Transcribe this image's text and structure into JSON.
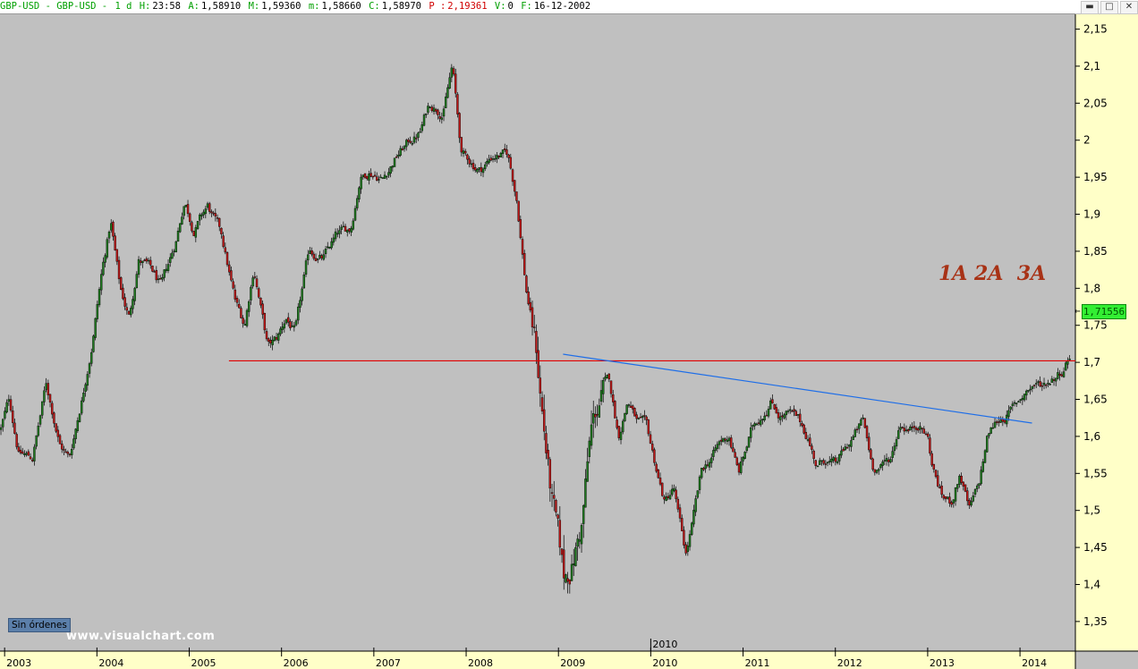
{
  "header": {
    "symbol": "GBP-USD - GBP-USD -",
    "period": "1 d",
    "h_label": "H:",
    "h_value": "23:58",
    "a_label": "A:",
    "a_value": "1,58910",
    "m_label": "M:",
    "m_value": "1,59360",
    "mn_label": "m:",
    "mn_value": "1,58660",
    "c_label": "C:",
    "c_value": "1,58970",
    "p_label": "P :",
    "p_value": "2,19361",
    "v_label": "V:",
    "v_value": "0",
    "f_label": "F:",
    "f_value": "16-12-2002"
  },
  "window_controls": [
    "▬",
    "□",
    "✕"
  ],
  "current_price": "1,71556",
  "annotation": "1A 2A  3A",
  "orders_button": "Sin órdenes",
  "watermark": "www.visualchart.com",
  "colors": {
    "up": "#1f7a1f",
    "down": "#c01818",
    "support_line": "#e00000",
    "trend_line": "#1e6ee8",
    "background": "#c0c0c0",
    "axis_bg": "#ffffc8"
  },
  "chart_data": {
    "type": "candlestick",
    "instrument": "GBP-USD",
    "timeframe": "1 d",
    "x_tick_labels": [
      "2003",
      "2004",
      "2005",
      "2006",
      "2007",
      "2008",
      "2009",
      "2010",
      "2011",
      "2012",
      "2013",
      "2014"
    ],
    "x_cursor_label": "2010",
    "y_tick_labels": [
      "2,15",
      "2,1",
      "2,05",
      "2",
      "1,95",
      "1,9",
      "1,85",
      "1,8",
      "1,75",
      "1,7",
      "1,65",
      "1,6",
      "1,55",
      "1,5",
      "1,45",
      "1,4",
      "1,35"
    ],
    "ylim": [
      1.31,
      2.17
    ],
    "xlim": [
      2002.95,
      2014.6
    ],
    "path": [
      [
        2002.96,
        1.61
      ],
      [
        2003.05,
        1.65
      ],
      [
        2003.15,
        1.58
      ],
      [
        2003.3,
        1.57
      ],
      [
        2003.45,
        1.67
      ],
      [
        2003.6,
        1.59
      ],
      [
        2003.7,
        1.57
      ],
      [
        2003.85,
        1.66
      ],
      [
        2003.95,
        1.73
      ],
      [
        2004.05,
        1.82
      ],
      [
        2004.15,
        1.89
      ],
      [
        2004.25,
        1.8
      ],
      [
        2004.35,
        1.76
      ],
      [
        2004.45,
        1.84
      ],
      [
        2004.55,
        1.83
      ],
      [
        2004.7,
        1.8
      ],
      [
        2004.85,
        1.86
      ],
      [
        2004.95,
        1.92
      ],
      [
        2005.05,
        1.88
      ],
      [
        2005.2,
        1.91
      ],
      [
        2005.35,
        1.87
      ],
      [
        2005.5,
        1.78
      ],
      [
        2005.6,
        1.75
      ],
      [
        2005.7,
        1.83
      ],
      [
        2005.85,
        1.72
      ],
      [
        2005.95,
        1.73
      ],
      [
        2006.05,
        1.76
      ],
      [
        2006.15,
        1.74
      ],
      [
        2006.3,
        1.85
      ],
      [
        2006.45,
        1.84
      ],
      [
        2006.6,
        1.87
      ],
      [
        2006.75,
        1.88
      ],
      [
        2006.85,
        1.95
      ],
      [
        2006.95,
        1.96
      ],
      [
        2007.1,
        1.95
      ],
      [
        2007.25,
        1.98
      ],
      [
        2007.4,
        2.0
      ],
      [
        2007.5,
        2.01
      ],
      [
        2007.6,
        2.05
      ],
      [
        2007.75,
        2.04
      ],
      [
        2007.85,
        2.1
      ],
      [
        2007.95,
        1.98
      ],
      [
        2008.05,
        1.97
      ],
      [
        2008.15,
        1.96
      ],
      [
        2008.3,
        1.98
      ],
      [
        2008.45,
        1.98
      ],
      [
        2008.55,
        1.92
      ],
      [
        2008.65,
        1.8
      ],
      [
        2008.75,
        1.73
      ],
      [
        2008.82,
        1.64
      ],
      [
        2008.92,
        1.52
      ],
      [
        2009.0,
        1.45
      ],
      [
        2009.06,
        1.4
      ],
      [
        2009.15,
        1.43
      ],
      [
        2009.25,
        1.48
      ],
      [
        2009.35,
        1.6
      ],
      [
        2009.45,
        1.65
      ],
      [
        2009.55,
        1.67
      ],
      [
        2009.65,
        1.6
      ],
      [
        2009.75,
        1.65
      ],
      [
        2009.85,
        1.62
      ],
      [
        2009.95,
        1.61
      ],
      [
        2010.05,
        1.56
      ],
      [
        2010.15,
        1.51
      ],
      [
        2010.25,
        1.53
      ],
      [
        2010.3,
        1.49
      ],
      [
        2010.38,
        1.44
      ],
      [
        2010.45,
        1.48
      ],
      [
        2010.55,
        1.55
      ],
      [
        2010.65,
        1.57
      ],
      [
        2010.75,
        1.59
      ],
      [
        2010.85,
        1.6
      ],
      [
        2010.95,
        1.55
      ],
      [
        2011.1,
        1.61
      ],
      [
        2011.2,
        1.63
      ],
      [
        2011.3,
        1.65
      ],
      [
        2011.4,
        1.63
      ],
      [
        2011.5,
        1.63
      ],
      [
        2011.6,
        1.62
      ],
      [
        2011.7,
        1.6
      ],
      [
        2011.8,
        1.56
      ],
      [
        2011.9,
        1.57
      ],
      [
        2012.0,
        1.56
      ],
      [
        2012.1,
        1.58
      ],
      [
        2012.2,
        1.6
      ],
      [
        2012.3,
        1.62
      ],
      [
        2012.4,
        1.56
      ],
      [
        2012.5,
        1.56
      ],
      [
        2012.6,
        1.57
      ],
      [
        2012.7,
        1.62
      ],
      [
        2012.8,
        1.61
      ],
      [
        2012.9,
        1.62
      ],
      [
        2013.0,
        1.6
      ],
      [
        2013.05,
        1.56
      ],
      [
        2013.15,
        1.52
      ],
      [
        2013.25,
        1.51
      ],
      [
        2013.35,
        1.55
      ],
      [
        2013.45,
        1.5
      ],
      [
        2013.55,
        1.53
      ],
      [
        2013.65,
        1.6
      ],
      [
        2013.75,
        1.62
      ],
      [
        2013.85,
        1.63
      ],
      [
        2013.95,
        1.64
      ],
      [
        2014.05,
        1.66
      ],
      [
        2014.15,
        1.67
      ],
      [
        2014.25,
        1.67
      ],
      [
        2014.35,
        1.68
      ],
      [
        2014.45,
        1.69
      ],
      [
        2014.55,
        1.716
      ]
    ],
    "horizontal_line": {
      "y": 1.702,
      "x_start": 2005.43,
      "x_end": 2014.6
    },
    "trend_line": {
      "start": [
        2009.05,
        1.711
      ],
      "end": [
        2014.13,
        1.618
      ]
    }
  }
}
